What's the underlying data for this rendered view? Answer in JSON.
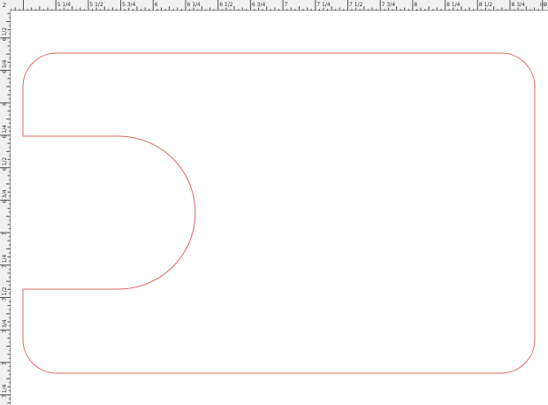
{
  "rulers": {
    "unit": "in",
    "origin": "Z",
    "top_labels": [
      "5 1/4",
      "5 1/2",
      "5 3/4",
      "6",
      "6 1/4",
      "6 1/2",
      "6 3/4",
      "7",
      "7 1/4",
      "7 1/2",
      "7 3/4",
      "8",
      "8 1/4",
      "8 1/2",
      "8 3/4",
      "9"
    ],
    "left_labels": [
      "6 1/2",
      "6 3/4",
      "6",
      "6 1/4",
      "6 1/2",
      "6 3/4",
      "7",
      "7 1/4",
      "7 1/2",
      "7 3/4",
      "7",
      "7 1/4"
    ]
  },
  "colors": {
    "outline": "#e06666",
    "ruler_bg": "#f0f0f0",
    "canvas_bg": "#ffffff"
  }
}
